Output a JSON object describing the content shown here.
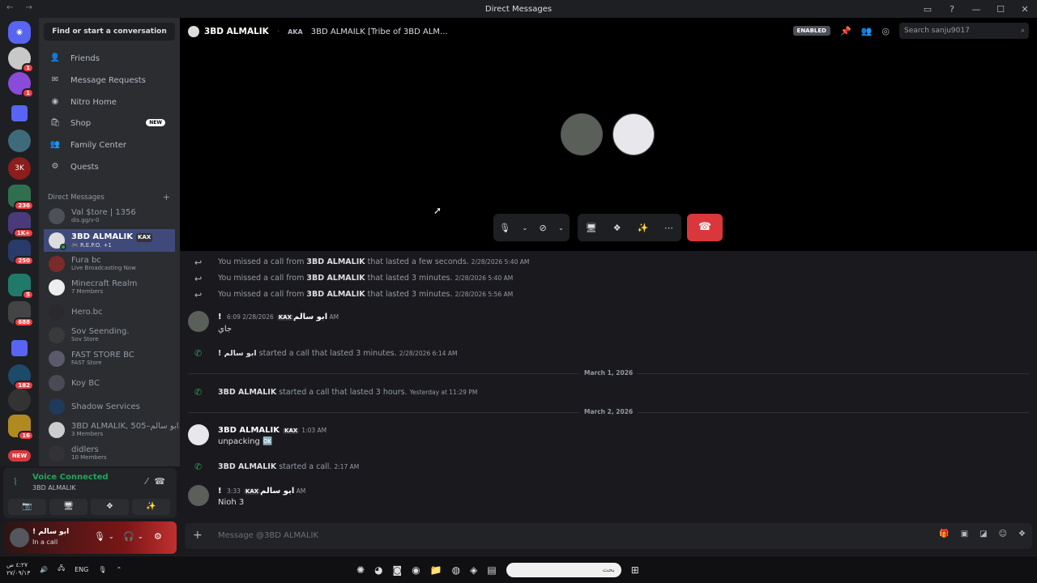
{
  "window": {
    "title": "Direct Messages",
    "nav": "← →",
    "controls": [
      "▭",
      "?",
      "—",
      "☐",
      "✕"
    ]
  },
  "servers": {
    "items": [
      {
        "label": "",
        "badge": ""
      },
      {
        "label": "",
        "badge": "1"
      },
      {
        "label": "",
        "badge": "1"
      },
      {
        "label": "▪",
        "badge": ""
      },
      {
        "label": "",
        "badge": ""
      },
      {
        "label": "3K",
        "badge": ""
      },
      {
        "label": "",
        "badge": "236"
      },
      {
        "label": "",
        "badge": "1K+"
      },
      {
        "label": "",
        "badge": "250"
      },
      {
        "label": "",
        "badge": "5"
      },
      {
        "label": "",
        "badge": "688"
      },
      {
        "label": "▪",
        "badge": ""
      },
      {
        "label": "",
        "badge": "182"
      },
      {
        "label": "",
        "badge": ""
      },
      {
        "label": "",
        "badge": "16"
      },
      {
        "label": "NEW",
        "badge": ""
      }
    ]
  },
  "dm_panel": {
    "find_button": "Find or start a conversation",
    "nav": [
      {
        "label": "Friends",
        "icon": "👤"
      },
      {
        "label": "Message Requests",
        "icon": "✉"
      },
      {
        "label": "Nitro Home",
        "icon": "◉"
      },
      {
        "label": "Shop",
        "icon": "🛍",
        "badge": "NEW"
      },
      {
        "label": "Family Center",
        "icon": "👥"
      },
      {
        "label": "Quests",
        "icon": "⚙"
      }
    ],
    "dm_header": "Direct Messages",
    "dm_add": "+",
    "conversations": [
      {
        "name": "Val $tore | 1356",
        "sub": "dis.gg/v-0",
        "active": false
      },
      {
        "name": "3BD ALMALIK",
        "tag": "KAX",
        "sub": "🎮 R.E.P.O. +1",
        "active": true
      },
      {
        "name": "Fura bc",
        "sub": "Live Broadcasting Now",
        "active": false
      },
      {
        "name": "Minecraft Realm",
        "sub": "7 Members",
        "active": false
      },
      {
        "name": "Hero.bc",
        "sub": "",
        "active": false
      },
      {
        "name": "Sov Seending.",
        "sub": "Sov Store",
        "active": false
      },
      {
        "name": "FAST STORE BC",
        "sub": "FAST Store",
        "active": false
      },
      {
        "name": "Koy BC",
        "sub": "",
        "active": false
      },
      {
        "name": "Shadow Services",
        "sub": "",
        "active": false
      },
      {
        "name": "3BD ALMALIK, 505–ابو سالم...",
        "sub": "3 Members",
        "active": false
      },
      {
        "name": "didlers",
        "sub": "10 Members",
        "active": false
      }
    ]
  },
  "voice": {
    "title": "Voice Connected",
    "sub": "3BD ALMALIK",
    "buttons": [
      "📷",
      "🖥",
      "❖",
      "✨"
    ]
  },
  "user": {
    "name": "! ابو سالم",
    "status": "In a call"
  },
  "channel_header": {
    "name": "3BD ALMALIK",
    "aka_label": "AKA",
    "aka_value": "3BD ALMAILK [Tribe of 3BD ALM...",
    "enabled": "ENABLED",
    "search_placeholder": "Search sanju9017"
  },
  "messages": {
    "system": [
      {
        "text": "You missed a call from ",
        "who": "3BD ALMALIK",
        "rest": " that lasted a few seconds.",
        "ts": "2/28/2026 5:40 AM"
      },
      {
        "text": "You missed a call from ",
        "who": "3BD ALMALIK",
        "rest": " that lasted 3 minutes.",
        "ts": "2/28/2026 5:40 AM"
      },
      {
        "text": "You missed a call from ",
        "who": "3BD ALMALIK",
        "rest": " that lasted 3 minutes.",
        "ts": "2/28/2026 5:56 AM"
      }
    ],
    "m1": {
      "author": "! ابو سالم",
      "tag": "KAX",
      "ts": "2/28/2026 6:09 AM",
      "body": "جاي"
    },
    "s4": {
      "who": "! ابو سالم",
      "rest": " started a call that lasted 3 minutes.",
      "ts": "2/28/2026 6:14 AM"
    },
    "div1": "March 1, 2026",
    "s5": {
      "who": "3BD ALMALIK",
      "rest": " started a call that lasted 3 hours.",
      "ts": "Yesterday at 11:29 PM"
    },
    "div2": "March 2, 2026",
    "m2": {
      "author": "3BD ALMALIK",
      "tag": "KAX",
      "ts": "1:03 AM",
      "body": "unpacking 🆗"
    },
    "s6": {
      "who": "3BD ALMALIK",
      "rest": " started a call.",
      "ts": "2:17 AM"
    },
    "m3": {
      "author": "! ابو سالم",
      "tag": "KAX",
      "ts": "3:33 AM",
      "body": "Nioh 3"
    }
  },
  "composer": {
    "placeholder": "Message @3BD ALMALIK"
  },
  "taskbar": {
    "time": "٤:٢٧ ص",
    "date": "٢٧/٠٩/١٣",
    "lang": "ENG",
    "search_placeholder": "بحث"
  }
}
